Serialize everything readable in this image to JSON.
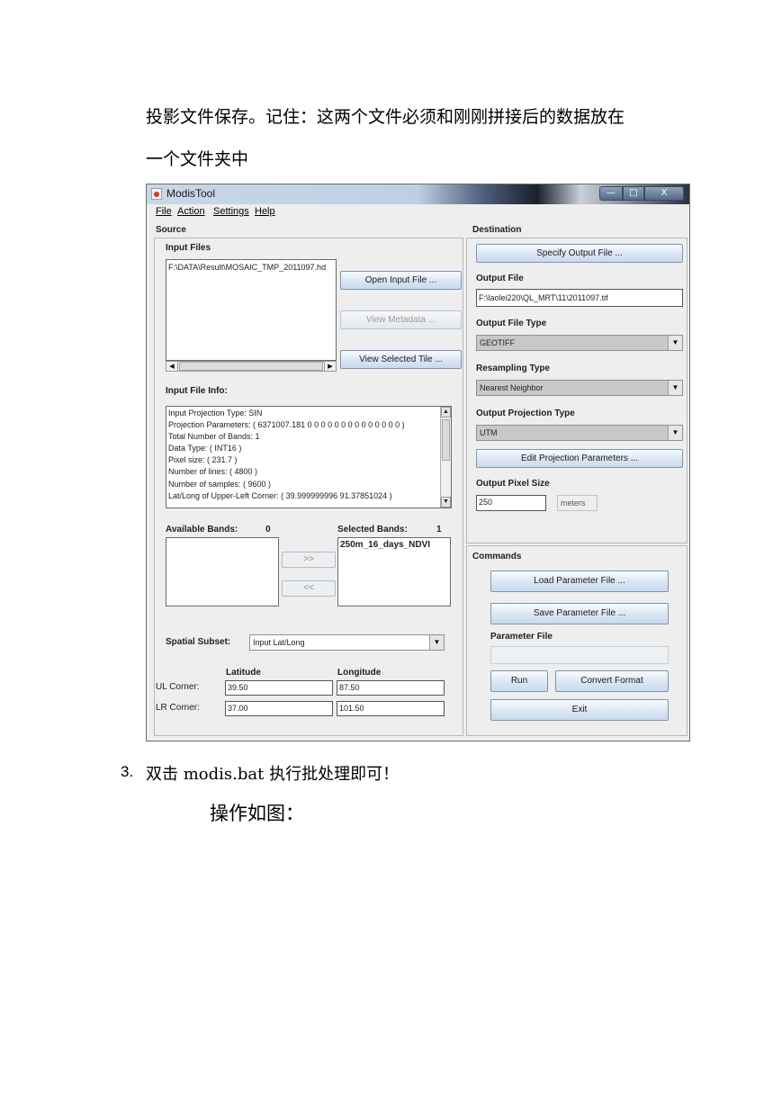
{
  "doc": {
    "line1": "投影文件保存。记住：这两个文件必须和刚刚拼接后的数据放在",
    "line2": "一个文件夹中",
    "item3_num": "3.",
    "item3_text": "双击 modis.bat 执行批处理即可！",
    "caption": "操作如图："
  },
  "window": {
    "title": "ModisTool",
    "min": "—",
    "max": "□",
    "close": "X"
  },
  "menu": {
    "file": "File",
    "action": "Action",
    "settings": "Settings",
    "help": "Help"
  },
  "source": {
    "header": "Source",
    "input_files_label": "Input Files",
    "input_file_value": "F:\\DATA\\Result\\MOSAIC_TMP_2011097.hd",
    "open_input_btn": "Open Input File ...",
    "view_metadata_btn": "View Metadata ...",
    "view_tile_btn": "View Selected Tile ...",
    "info_label": "Input File Info:",
    "info_lines": [
      "Input Projection Type: SIN",
      "Projection Parameters: ( 6371007.181 0 0 0 0 0 0 0 0 0 0 0 0 0 0 )",
      "Total Number of Bands: 1",
      "Data Type: ( INT16 )",
      "Pixel size: ( 231.7 )",
      "Number of lines: ( 4800 )",
      "Number of samples: ( 9600 )",
      "Lat/Long of Upper-Left Corner: ( 39.999999996 91.37851024 )"
    ],
    "available_label": "Available Bands:",
    "available_count": "0",
    "selected_label": "Selected Bands:",
    "selected_count": "1",
    "selected_band": "250m_16_days_NDVI",
    "add_btn": ">>",
    "remove_btn": "<<",
    "subset_label": "Spatial Subset:",
    "subset_value": "Input Lat/Long",
    "lat_header": "Latitude",
    "lon_header": "Longitude",
    "ul_label": "UL Corner:",
    "lr_label": "LR Corner:",
    "ul_lat": "39.50",
    "ul_lon": "87.50",
    "lr_lat": "37.00",
    "lr_lon": "101.50"
  },
  "dest": {
    "header": "Destination",
    "specify_btn": "Specify Output File ...",
    "output_file_label": "Output File",
    "output_file_value": "F:\\laolei220\\QL_MRT\\11\\2011097.tif",
    "type_label": "Output File Type",
    "type_value": "GEOTIFF",
    "resampling_label": "Resampling Type",
    "resampling_value": "Nearest Neighbor",
    "proj_label": "Output Projection Type",
    "proj_value": "UTM",
    "edit_proj_btn": "Edit Projection Parameters ...",
    "pixel_label": "Output Pixel Size",
    "pixel_value": "250",
    "pixel_unit": "meters"
  },
  "commands": {
    "header": "Commands",
    "load_btn": "Load Parameter File ...",
    "save_btn": "Save Parameter File ...",
    "param_label": "Parameter File",
    "run_btn": "Run",
    "convert_btn": "Convert Format",
    "exit_btn": "Exit"
  }
}
